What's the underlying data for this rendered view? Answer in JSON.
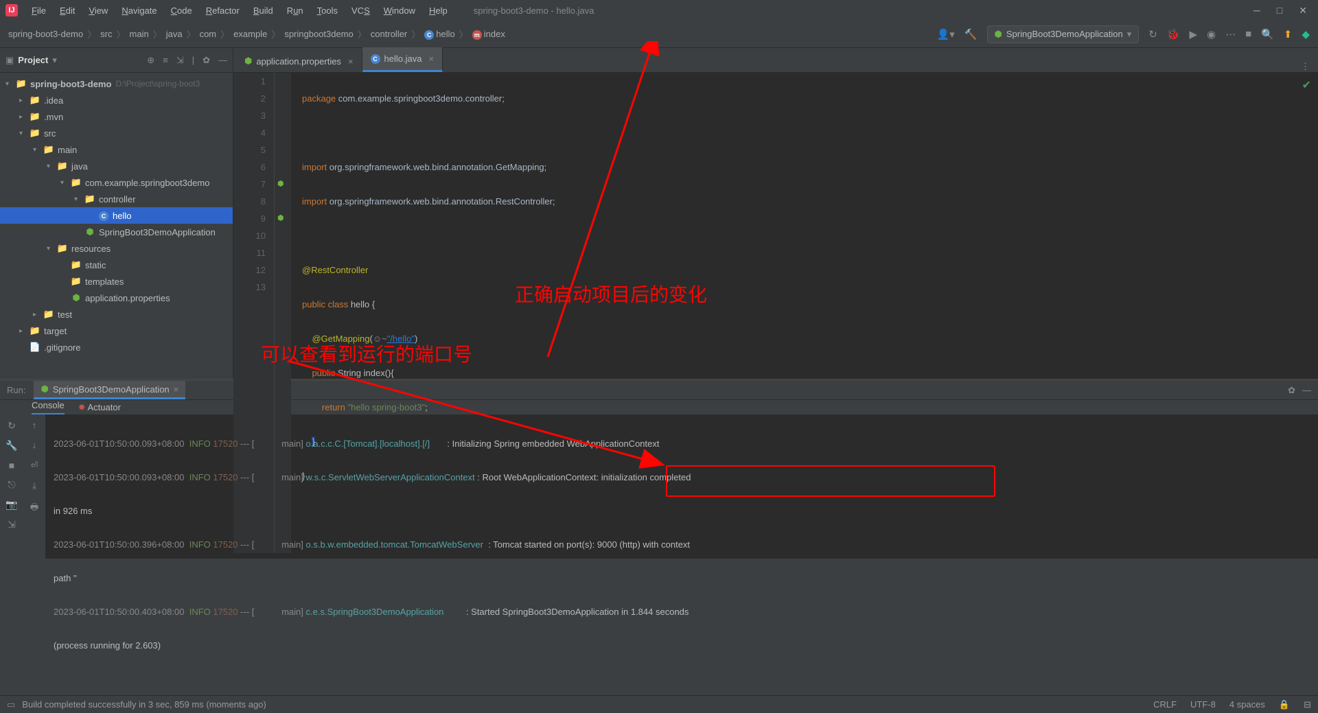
{
  "window": {
    "title": "spring-boot3-demo - hello.java"
  },
  "menu": [
    "File",
    "Edit",
    "View",
    "Navigate",
    "Code",
    "Refactor",
    "Build",
    "Run",
    "Tools",
    "VCS",
    "Window",
    "Help"
  ],
  "breadcrumb": [
    "spring-boot3-demo",
    "src",
    "main",
    "java",
    "com",
    "example",
    "springboot3demo",
    "controller",
    "hello",
    "index"
  ],
  "runConfig": "SpringBoot3DemoApplication",
  "projectPanel": {
    "title": "Project"
  },
  "tree": {
    "root": "spring-boot3-demo",
    "rootPath": "D:\\Project\\spring-boot3",
    "idea": ".idea",
    "mvn": ".mvn",
    "src": "src",
    "main_": "main",
    "java": "java",
    "pkg": "com.example.springboot3demo",
    "controller": "controller",
    "helloClass": "hello",
    "appClass": "SpringBoot3DemoApplication",
    "resources": "resources",
    "static_": "static",
    "templates": "templates",
    "appProps": "application.properties",
    "test": "test",
    "target": "target",
    "gitignore": ".gitignore"
  },
  "tabs": {
    "t1": "application.properties",
    "t2": "hello.java"
  },
  "code": {
    "l1_kw": "package",
    "l1_pkg": " com.example.springboot3demo.controller;",
    "l3_kw": "import",
    "l3_pkg": " org.springframework.web.bind.annotation.",
    "l3_cls": "GetMapping",
    "l3_end": ";",
    "l4_kw": "import",
    "l4_pkg": " org.springframework.web.bind.annotation.",
    "l4_cls": "RestController",
    "l4_end": ";",
    "l6_ann": "@RestController",
    "l7_kw1": "public ",
    "l7_kw2": "class ",
    "l7_name": "hello {",
    "l8_ann": "@GetMapping",
    "l8_p1": "(",
    "l8_ic": "☺~",
    "l8_url": "\"/hello\"",
    "l8_p2": ")",
    "l9_kw1": "public ",
    "l9_type": "String ",
    "l9_name": "index(){",
    "l10_kw": "return ",
    "l10_str": "\"hello spring-boot3\"",
    "l10_end": ";",
    "l11": "}",
    "l12": "}"
  },
  "lineNumbers": [
    "1",
    "2",
    "3",
    "4",
    "5",
    "6",
    "7",
    "8",
    "9",
    "10",
    "11",
    "12",
    "13"
  ],
  "annotations": {
    "red1": "正确启动项目后的变化",
    "red2": "可以查看到运行的端口号"
  },
  "runPanel": {
    "label": "Run:",
    "tab": "SpringBoot3DemoApplication",
    "console": "Console",
    "actuator": "Actuator"
  },
  "log": {
    "l1_ts": "2023-06-01T10:50:00.093+08:00",
    "l1_info": "INFO",
    "l1_pid": "17520",
    "l1_sep": " --- [",
    "l1_thr": "           main] ",
    "l1_src": "o.a.c.c.C.[Tomcat].[localhost].[/]      ",
    "l1_msg": " : Initializing Spring embedded WebApplicationContext",
    "l2_ts": "2023-06-01T10:50:00.093+08:00",
    "l2_info": "INFO",
    "l2_pid": "17520",
    "l2_sep": " --- [",
    "l2_thr": "           main] ",
    "l2_src": "w.s.c.ServletWebServerApplicationContext",
    "l2_msg": " : Root WebApplicationContext: initialization completed",
    "l2b": "in 926 ms",
    "l3_ts": "2023-06-01T10:50:00.396+08:00",
    "l3_info": "INFO",
    "l3_pid": "17520",
    "l3_sep": " --- [",
    "l3_thr": "           main] ",
    "l3_src": "o.s.b.w.embedded.tomcat.TomcatWebServer ",
    "l3_msg": " : Tomcat started on port(s): 9000 (http) with context",
    "l3b": "path ''",
    "l4_ts": "2023-06-01T10:50:00.403+08:00",
    "l4_info": "INFO",
    "l4_pid": "17520",
    "l4_sep": " --- [",
    "l4_thr": "           main] ",
    "l4_src": "c.e.s.SpringBoot3DemoApplication        ",
    "l4_msg": " : Started SpringBoot3DemoApplication in 1.844 seconds",
    "l4b": "(process running for 2.603)"
  },
  "statusBar": {
    "msg": "Build completed successfully in 3 sec, 859 ms (moments ago)",
    "crlf": "CRLF",
    "enc": "UTF-8",
    "indent": "4 spaces"
  }
}
